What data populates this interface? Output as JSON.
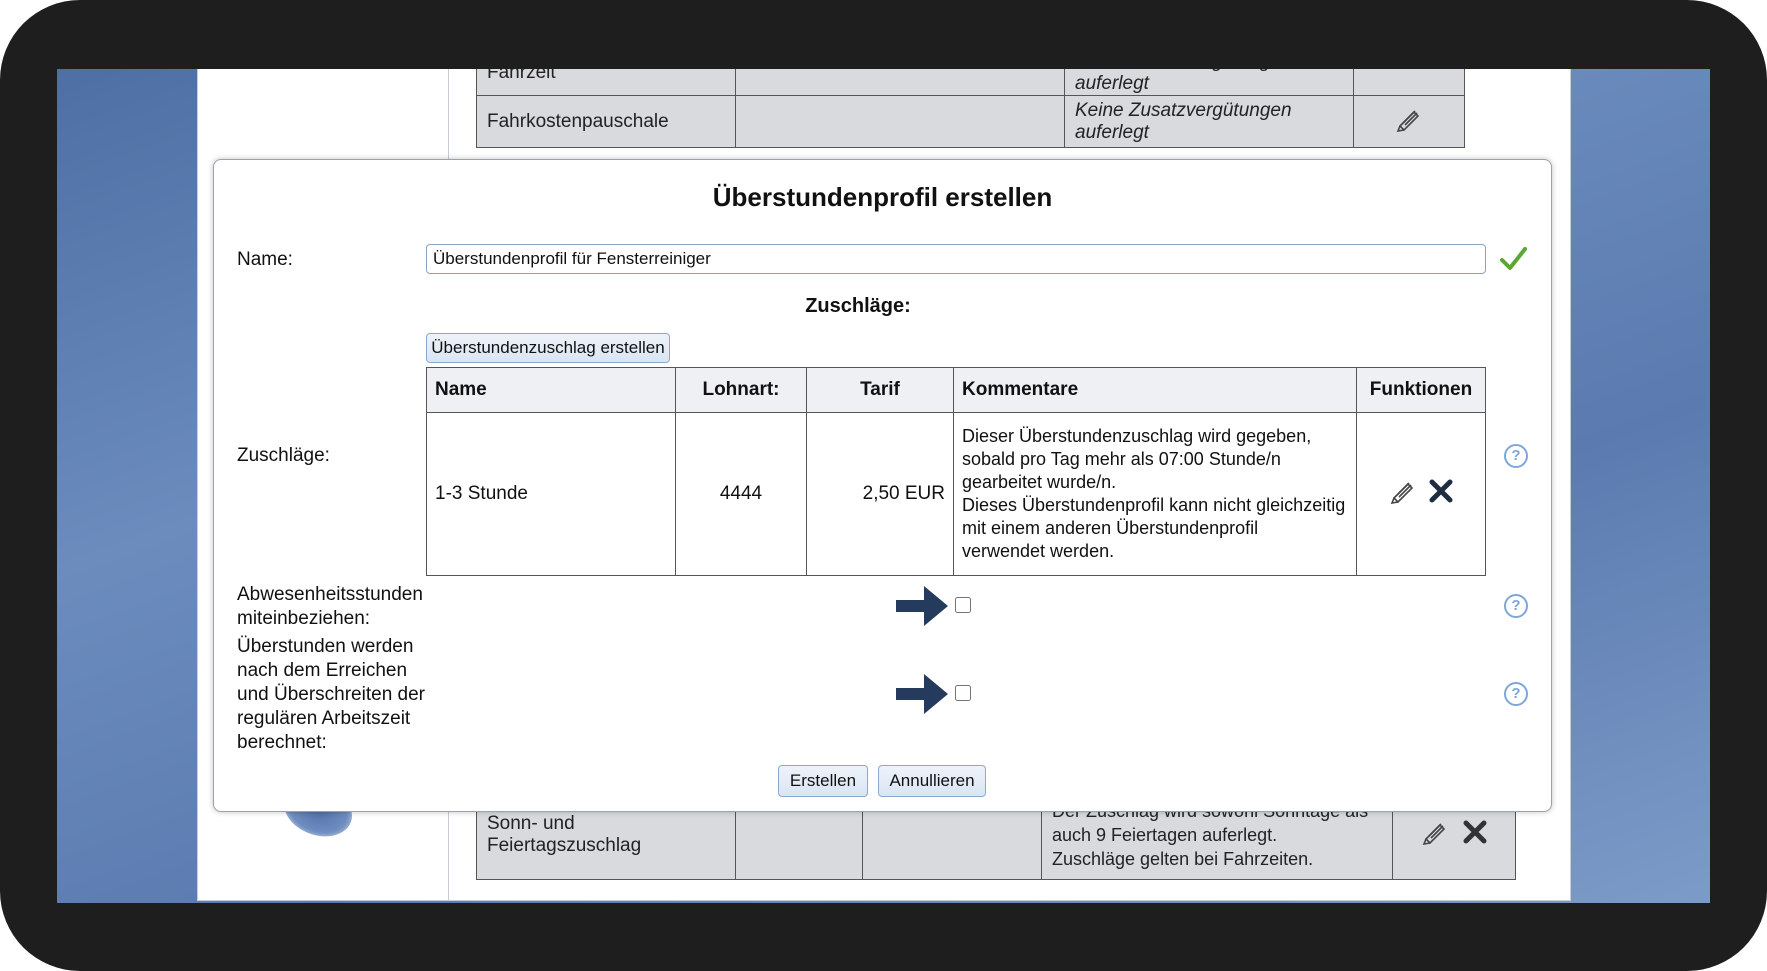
{
  "background_table": {
    "row_cut": {
      "name": "Fahrzeit",
      "comment": "Keine Zusatzvergütungen auferlegt"
    },
    "row_fahrkosten": {
      "name": "Fahrkostenpauschale",
      "comment": "Keine Zusatzvergütungen auferlegt"
    },
    "row_sonn": {
      "name": "Sonn- und Feiertagszuschlag",
      "comment_line1": "Der Zuschlag wird sowohl Sonntage als",
      "comment_line2": "auch 9 Feiertagen auferlegt.",
      "comment_line3": "Zuschläge gelten bei Fahrzeiten."
    }
  },
  "modal": {
    "title": "Überstundenprofil erstellen",
    "name_label": "Name:",
    "name_value": "Überstundenprofil für Fensterreiniger",
    "zuschlaege_heading": "Zuschläge:",
    "zuschlaege_label": "Zuschläge:",
    "create_surcharge_button": "Überstundenzuschlag erstellen",
    "table": {
      "headers": [
        "Name",
        "Lohnart:",
        "Tarif",
        "Kommentare",
        "Funktionen"
      ],
      "rows": [
        {
          "name": "1-3 Stunde",
          "lohnart": "4444",
          "tarif": "2,50 EUR",
          "comment_lines": [
            "Dieser Überstundenzuschlag wird gegeben,",
            "sobald pro Tag mehr als 07:00 Stunde/n",
            "gearbeitet wurde/n.",
            "Dieses Überstundenprofil kann nicht gleichzeitig",
            "mit einem anderen Überstundenprofil",
            "verwendet werden."
          ]
        }
      ]
    },
    "absence_label_line1": "Abwesenheitsstunden",
    "absence_label_line2": "miteinbeziehen:",
    "absence_checked": false,
    "overtime_label_lines": [
      "Überstunden werden",
      "nach dem Erreichen",
      "und Überschreiten der",
      "regulären Arbeitszeit",
      "berechnet:"
    ],
    "overtime_checked": false,
    "submit_button": "Erstellen",
    "cancel_button": "Annullieren"
  },
  "colors": {
    "arrow": "#253b5e",
    "check": "#5aa832",
    "help": "#7fa6d8",
    "button_border": "#8da8cc"
  },
  "icons": {
    "edit": "pencil-icon",
    "delete": "x-icon",
    "help": "question-circle-icon",
    "valid": "checkmark-icon",
    "pointer": "arrow-right-icon"
  }
}
